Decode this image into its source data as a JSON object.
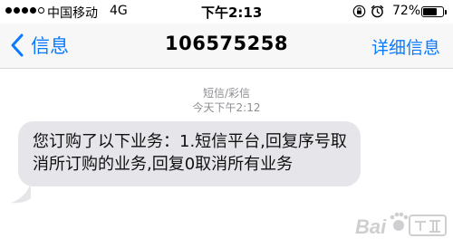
{
  "status_bar": {
    "signal_bars_filled": 4,
    "signal_bars_total": 5,
    "carrier": "中国移动",
    "network": "4G",
    "time": "下午2:13",
    "battery_percent": "72%",
    "battery_level": 0.72
  },
  "nav": {
    "back_label": "信息",
    "title": "106575258",
    "details_label": "详细信息"
  },
  "conversation": {
    "message_type": "短信/彩信",
    "timestamp": "今天下午2:12",
    "messages": [
      {
        "direction": "incoming",
        "text": "您订购了以下业务：1.短信平台,回复序号取消所订购的业务,回复0取消所有业务"
      }
    ]
  },
  "icons": {
    "back": "chevron-left-icon",
    "lock": "rotation-lock-icon",
    "alarm": "alarm-clock-icon",
    "battery": "battery-icon"
  },
  "colors": {
    "accent": "#0a7bff",
    "bubble_incoming": "#e5e5ea",
    "meta_text": "#8e8e93"
  }
}
